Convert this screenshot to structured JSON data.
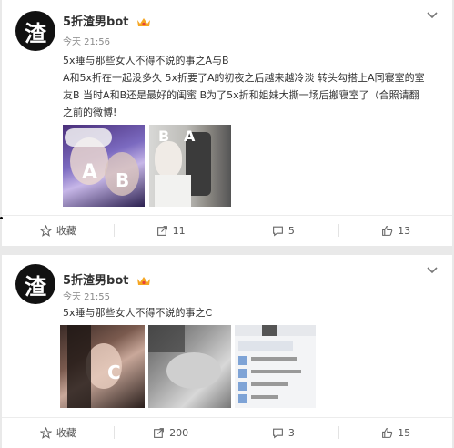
{
  "posts": [
    {
      "user_name": "5折渣男bot",
      "avatar_char": "渣",
      "time": "今天 21:56",
      "text_line1": "5x睡与那些女人不得不说的事之A与B",
      "text_line2": "A和5x折在一起没多久 5x折要了A的初夜之后越来越冷淡 转头勾搭上A同寝室的室",
      "text_line3": "友B 当时A和B还是最好的闺蜜 B为了5x折和姐妹大撕一场后搬寝室了（合照请翻",
      "text_line4": "之前的微博!",
      "image_labels": [
        "A",
        "B",
        "B",
        "A"
      ],
      "actions": {
        "favorite": "收藏",
        "repost": "11",
        "comment": "5",
        "like": "13"
      }
    },
    {
      "user_name": "5折渣男bot",
      "avatar_char": "渣",
      "time": "今天 21:55",
      "text_line1": "5x睡与那些女人不得不说的事之C",
      "image_labels": [
        "C"
      ],
      "actions": {
        "favorite": "收藏",
        "repost": "200",
        "comment": "3",
        "like": "15"
      }
    }
  ],
  "icons": [
    "vip-crown-icon",
    "chevron-down-icon",
    "star-icon",
    "repost-icon",
    "comment-icon",
    "thumbs-up-icon"
  ],
  "colors": {
    "background": "#e9e9e9",
    "card": "#ffffff",
    "text": "#333333",
    "meta": "#888888",
    "crown": "#f5a623"
  }
}
